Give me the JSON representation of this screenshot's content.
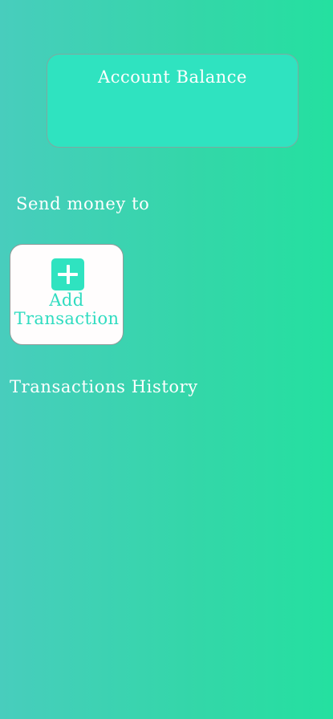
{
  "balance_card": {
    "title": "Account Balance"
  },
  "send_section": {
    "title": "Send money to",
    "add_transaction": {
      "icon": "plus-icon",
      "label_line1": "Add",
      "label_line2": "Transaction"
    }
  },
  "history_section": {
    "title": "Transactions History"
  },
  "colors": {
    "accent": "#2fe3c0",
    "background_start": "#48cdbd",
    "background_end": "#24e0a0",
    "card_white": "#fffdfd"
  }
}
